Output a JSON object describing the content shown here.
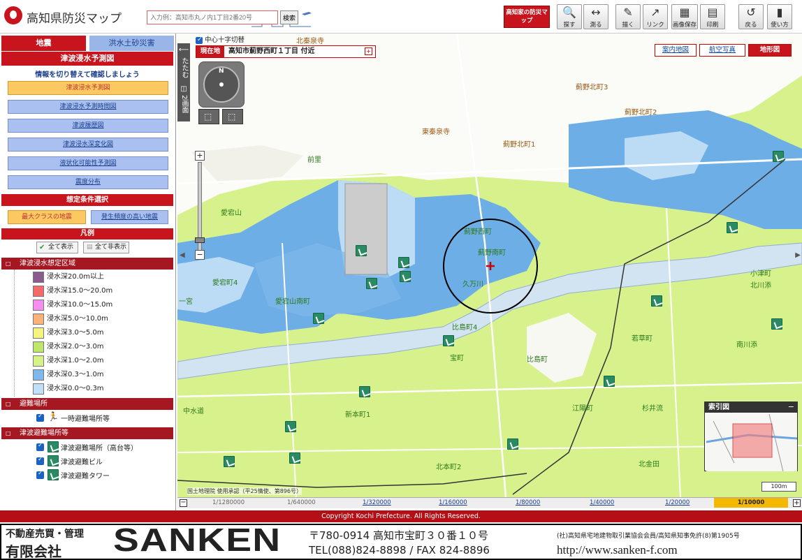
{
  "header": {
    "app_title": "高知県防災マップ",
    "search_placeholder": "入力例：高知市丸ノ内1丁目2番20号",
    "search_button": "検索",
    "kochi_button": "高知家の防災マップ",
    "tools": [
      {
        "icon": "magnifier-icon",
        "label": "探す"
      },
      {
        "icon": "measure-icon",
        "label": "測る"
      },
      {
        "icon": "draw-icon",
        "label": "描く"
      },
      {
        "icon": "link-icon",
        "label": "リンク"
      },
      {
        "icon": "save-image-icon",
        "label": "画像保存"
      },
      {
        "icon": "printer-icon",
        "label": "印刷"
      },
      {
        "icon": "back-icon",
        "label": "戻る"
      },
      {
        "icon": "help-icon",
        "label": "使い方"
      }
    ]
  },
  "left": {
    "tab_earthquake": "地震",
    "tab_flood": "洪水土砂災害",
    "tsunami_title": "津波浸水予測図",
    "subtitle": "情報を切り替えて確認しましょう",
    "view_buttons": [
      "津波浸水予測図",
      "津波浸水予測時間図",
      "津波履歴図",
      "津波浸水深変化図",
      "液状化可能性予測図",
      "震度分布"
    ],
    "condition_title": "想定条件選択",
    "condition_buttons": [
      "最大クラスの地震",
      "発生頻度の高い地震"
    ],
    "legend_title": "凡例",
    "show_all": "全て表示",
    "hide_all": "全て非表示",
    "group_tsunami_area": "津波浸水想定区域",
    "depth_items": [
      {
        "label": "浸水深20.0m以上",
        "color": "#8b5a8f"
      },
      {
        "label": "浸水深15.0～20.0m",
        "color": "#f46a6a"
      },
      {
        "label": "浸水深10.0～15.0m",
        "color": "#f48ef0"
      },
      {
        "label": "浸水深5.0～10.0m",
        "color": "#f9b278"
      },
      {
        "label": "浸水深3.0～5.0m",
        "color": "#f6f480"
      },
      {
        "label": "浸水深2.0～3.0m",
        "color": "#bfe66a"
      },
      {
        "label": "浸水深1.0～2.0m",
        "color": "#d8f28a"
      },
      {
        "label": "浸水深0.3～1.0m",
        "color": "#7fb8ea"
      },
      {
        "label": "浸水深0.0～0.3m",
        "color": "#bfe0f8"
      }
    ],
    "group_evac": "避難場所",
    "evac_items": [
      {
        "label": "一時避難場所等"
      }
    ],
    "group_tsunami_evac": "津波避難場所等",
    "tsunami_evac_items": [
      {
        "label": "津波避難場所（高台等）"
      },
      {
        "label": "津波避難ビル"
      },
      {
        "label": "津波避難タワー"
      }
    ]
  },
  "map": {
    "center_cross_label": "中心十字切替",
    "current_location_label": "現在地",
    "current_location_value": "高知市薊野西町１丁目 付近",
    "fold_label": "たたむ",
    "split_label": "2画面",
    "compass_n": "N",
    "basemaps": [
      "案内地図",
      "航空写真",
      "地形図"
    ],
    "active_basemap": "地形図",
    "source_note": "国土地理院 使用承認（平25情使、第896号）",
    "scale_bar": "100m",
    "index_map_title": "索引図",
    "labels": [
      "北秦泉寺",
      "薊野北町3",
      "薊野北町2",
      "薊野北町1",
      "東秦泉寺",
      "薊野西町",
      "薊野南町",
      "前里",
      "愛宕山",
      "愛宕町4",
      "久万川",
      "北川添",
      "比島町4",
      "比島町",
      "若草町",
      "南川添",
      "宝町",
      "中水道",
      "新本町1",
      "江陽町",
      "杉井流",
      "北本町2",
      "北金田",
      "小津町",
      "愛宕山南町",
      "一宮"
    ]
  },
  "zoom_bar": {
    "scales": [
      "1/1280000",
      "1/640000",
      "1/320000",
      "1/160000",
      "1/80000",
      "1/40000",
      "1/20000",
      "1/10000"
    ],
    "active": "1/10000"
  },
  "copyright": "Copyright Kochi Prefecture. All Rights Reserved.",
  "ad": {
    "line1": "不動産売買・管理",
    "company": "有限会社",
    "brand": "SANKEN",
    "postal_address": "〒780-0914 高知市宝町３０番１０号",
    "phone_fax": "TEL(088)824-8898 / FAX 824-8896",
    "license": "(社)高知県宅地建物取引業協会会員/高知県知事免許(8)第1905号",
    "url": "http://www.sanken-f.com"
  },
  "colors": {
    "brand_red": "#c8151d",
    "dark_red": "#a51822",
    "tab_blue": "#9ab6e8",
    "active_orange": "#fcc861"
  }
}
